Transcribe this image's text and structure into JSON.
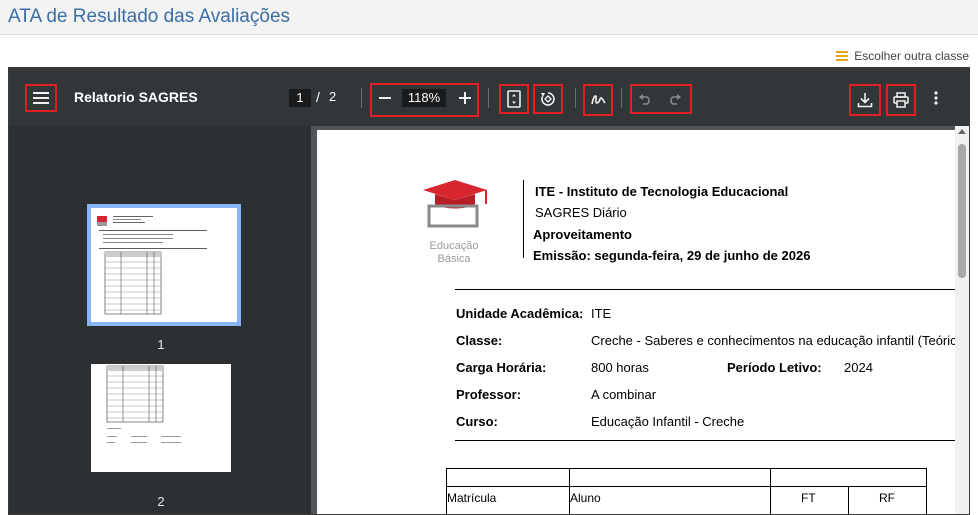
{
  "page": {
    "title": "ATA de Resultado das Avaliações",
    "choose_class_label": "Escolher outra classe"
  },
  "viewer": {
    "doc_title": "Relatorio SAGRES",
    "current_page": "1",
    "page_separator": "/",
    "total_pages": "2",
    "zoom": "118%",
    "thumbnails": [
      "1",
      "2"
    ]
  },
  "report": {
    "institution": "ITE - Instituto de Tecnologia Educacional",
    "system": "SAGRES Diário",
    "report_type": "Aproveitamento",
    "emission": "Emissão: segunda-feira, 29 de junho de 2026",
    "logo_caption_line1": "Educação",
    "logo_caption_line2": "Básica",
    "fields": {
      "unit_label": "Unidade Acadêmica:",
      "unit_value": "ITE",
      "class_label": "Classe:",
      "class_value": "Creche - Saberes e conhecimentos na educação infantil (Teórica -",
      "hours_label": "Carga Horária:",
      "hours_value": "800 horas",
      "period_label": "Período Letivo:",
      "period_value": "2024",
      "teacher_label": "Professor:",
      "teacher_value": "A combinar",
      "course_label": "Curso:",
      "course_value": "Educação Infantil - Creche"
    },
    "table_headers": [
      "Matrícula",
      "Aluno",
      "FT",
      "RF"
    ]
  },
  "colors": {
    "title": "#3a6ea5",
    "toolbar": "#323639",
    "sidebar": "#2d3033",
    "highlight": "#e02020",
    "accent": "#e8a317"
  }
}
